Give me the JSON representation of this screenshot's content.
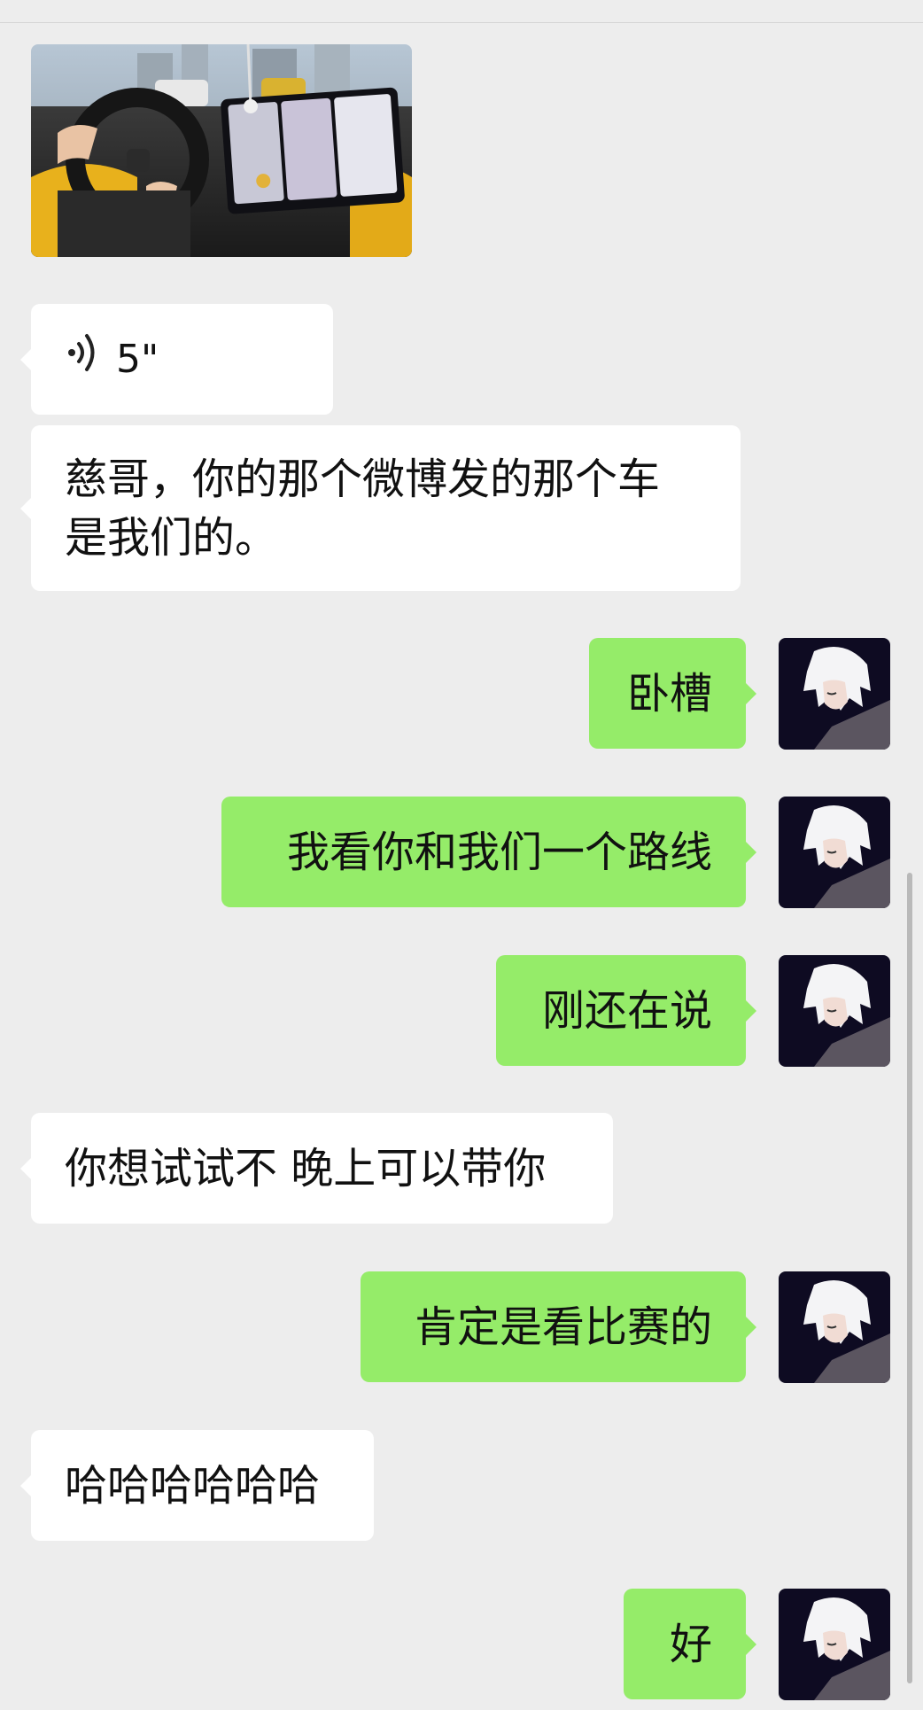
{
  "messages": [
    {
      "id": "m1",
      "side": "left",
      "type": "image",
      "alt": ""
    },
    {
      "id": "m2",
      "side": "left",
      "type": "voice",
      "duration": "5\""
    },
    {
      "id": "m3",
      "side": "left",
      "type": "text",
      "lines": [
        "慈哥，你的那个微博发的那个车",
        "是我们的。"
      ]
    },
    {
      "id": "m4",
      "side": "right",
      "type": "text",
      "text": "卧槽"
    },
    {
      "id": "m5",
      "side": "right",
      "type": "text",
      "text": "我看你和我们一个路线"
    },
    {
      "id": "m6",
      "side": "right",
      "type": "text",
      "text": "刚还在说"
    },
    {
      "id": "m7",
      "side": "left",
      "type": "text",
      "text": "你想试试不 晚上可以带你"
    },
    {
      "id": "m8",
      "side": "right",
      "type": "text",
      "text": "肯定是看比赛的"
    },
    {
      "id": "m9",
      "side": "left",
      "type": "text",
      "text": "哈哈哈哈哈哈"
    },
    {
      "id": "m10",
      "side": "right",
      "type": "text",
      "text": "好"
    }
  ],
  "colors": {
    "background": "#ededed",
    "bubble_in": "#ffffff",
    "bubble_out": "#95ec69",
    "text": "#111111"
  },
  "icons": {
    "voice": "voice-wave-icon",
    "avatar": "avatar-icon"
  }
}
